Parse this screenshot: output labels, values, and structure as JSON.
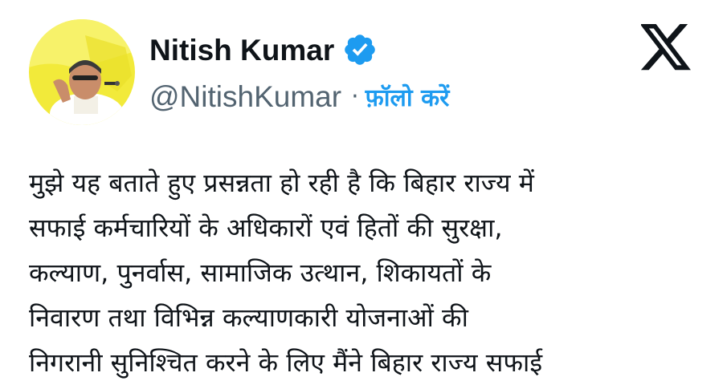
{
  "profile": {
    "name": "Nitish Kumar",
    "handle": "@NitishKumar",
    "separator": "·",
    "follow_label": "फ़ॉलो करें",
    "verified_icon": "verified-badge-icon",
    "avatar_icon": "profile-photo"
  },
  "brand": {
    "logo": "x-logo-icon"
  },
  "tweet": {
    "lines": [
      "मुझे यह बताते हुए प्रसन्नता हो रही है कि बिहार राज्य में",
      "सफाई कर्मचारियों के अधिकारों एवं हितों की सुरक्षा,",
      "कल्याण, पुनर्वास, सामाजिक उत्थान, शिकायतों के",
      "निवारण तथा विभिन्न कल्याणकारी योजनाओं की",
      "निगरानी सुनिश्चित करने के लिए मैंने बिहार राज्य सफाई"
    ]
  },
  "colors": {
    "accent": "#1d9bf0",
    "text": "#0f1419",
    "secondary": "#536471",
    "avatar_bg": "#f2ea3a"
  }
}
